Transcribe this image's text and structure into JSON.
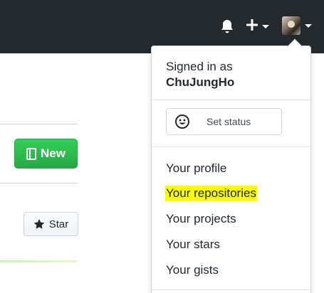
{
  "header": {
    "bell_icon": "bell-icon",
    "plus_icon": "plus-icon",
    "avatar_icon": "avatar"
  },
  "page": {
    "new_button_label": "New",
    "new_icon": "book-icon",
    "star_button_label": "Star",
    "star_icon": "star-icon"
  },
  "dropdown": {
    "signed_in_label": "Signed in as",
    "username": "ChuJungHo",
    "set_status_label": "Set status",
    "items": [
      {
        "label": "Your profile"
      },
      {
        "label": "Your repositories",
        "highlighted": true
      },
      {
        "label": "Your projects"
      },
      {
        "label": "Your stars"
      },
      {
        "label": "Your gists"
      }
    ]
  },
  "colors": {
    "header_bg": "#24292e",
    "new_button": "#28a745",
    "highlight": "#fbff00"
  }
}
